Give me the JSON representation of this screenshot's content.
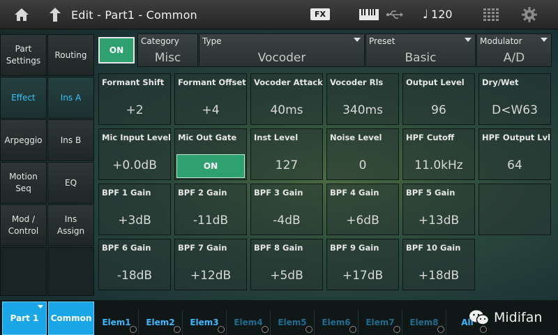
{
  "topbar": {
    "title": "Edit - Part1 - Common",
    "fx_badge": "FX",
    "tempo": "120",
    "icons": [
      "home-icon",
      "up-arrow-icon",
      "keyboard-icon",
      "usb-icon",
      "note-icon",
      "grid-icon",
      "gear-icon"
    ]
  },
  "nav_left": [
    {
      "label": "Part Settings",
      "active": false
    },
    {
      "label": "Effect",
      "active": true
    },
    {
      "label": "Arpeggio",
      "active": false
    },
    {
      "label": "Motion Seq",
      "active": false
    },
    {
      "label": "Mod / Control",
      "active": false
    }
  ],
  "nav_right": [
    {
      "label": "Routing",
      "active": false
    },
    {
      "label": "Ins A",
      "active": true
    },
    {
      "label": "Ins B",
      "active": false
    },
    {
      "label": "EQ",
      "active": false
    },
    {
      "label": "Ins Assign",
      "active": false
    }
  ],
  "header": {
    "on_label": "ON",
    "category": {
      "label": "Category",
      "value": "Misc"
    },
    "type": {
      "label": "Type",
      "value": "Vocoder"
    },
    "preset": {
      "label": "Preset",
      "value": "Basic"
    },
    "modulator": {
      "label": "Modulator",
      "value": "A/D"
    }
  },
  "params": [
    {
      "label": "Formant Shift",
      "value": "+2"
    },
    {
      "label": "Formant Offset",
      "value": "+4"
    },
    {
      "label": "Vocoder Attack",
      "value": "40ms"
    },
    {
      "label": "Vocoder Rls",
      "value": "340ms"
    },
    {
      "label": "Output Level",
      "value": "96"
    },
    {
      "label": "Dry/Wet",
      "value": "D<W63"
    },
    {
      "label": "Mic Input Level",
      "value": "+0.0dB"
    },
    {
      "label": "Mic Out Gate",
      "value": "ON"
    },
    {
      "label": "Inst Level",
      "value": "127"
    },
    {
      "label": "Noise Level",
      "value": "0"
    },
    {
      "label": "HPF Cutoff",
      "value": "11.0kHz"
    },
    {
      "label": "HPF Output Lvl",
      "value": "64"
    },
    {
      "label": "BPF 1 Gain",
      "value": "+3dB"
    },
    {
      "label": "BPF 2 Gain",
      "value": "-11dB"
    },
    {
      "label": "BPF 3 Gain",
      "value": "-4dB"
    },
    {
      "label": "BPF 4 Gain",
      "value": "+6dB"
    },
    {
      "label": "BPF 5 Gain",
      "value": "+13dB"
    },
    {
      "label": "BPF 6 Gain",
      "value": "-18dB"
    },
    {
      "label": "BPF 7 Gain",
      "value": "+12dB"
    },
    {
      "label": "BPF 8 Gain",
      "value": "+5dB"
    },
    {
      "label": "BPF 9 Gain",
      "value": "+17dB"
    },
    {
      "label": "BPF 10 Gain",
      "value": "+18dB"
    }
  ],
  "bottombar": {
    "part_label": "Part 1",
    "common_label": "Common",
    "elements": [
      {
        "label": "Elem1",
        "on": true
      },
      {
        "label": "Elem2",
        "on": true
      },
      {
        "label": "Elem3",
        "on": true
      },
      {
        "label": "Elem4",
        "on": false
      },
      {
        "label": "Elem5",
        "on": false
      },
      {
        "label": "Elem6",
        "on": false
      },
      {
        "label": "Elem7",
        "on": false
      },
      {
        "label": "Elem8",
        "on": false
      },
      {
        "label": "All",
        "on": true
      }
    ],
    "brand": "Midifan"
  },
  "colors": {
    "accent_blue": "#1ba6e8",
    "active_text": "#35c5ff",
    "on_green": "#2fa070"
  }
}
